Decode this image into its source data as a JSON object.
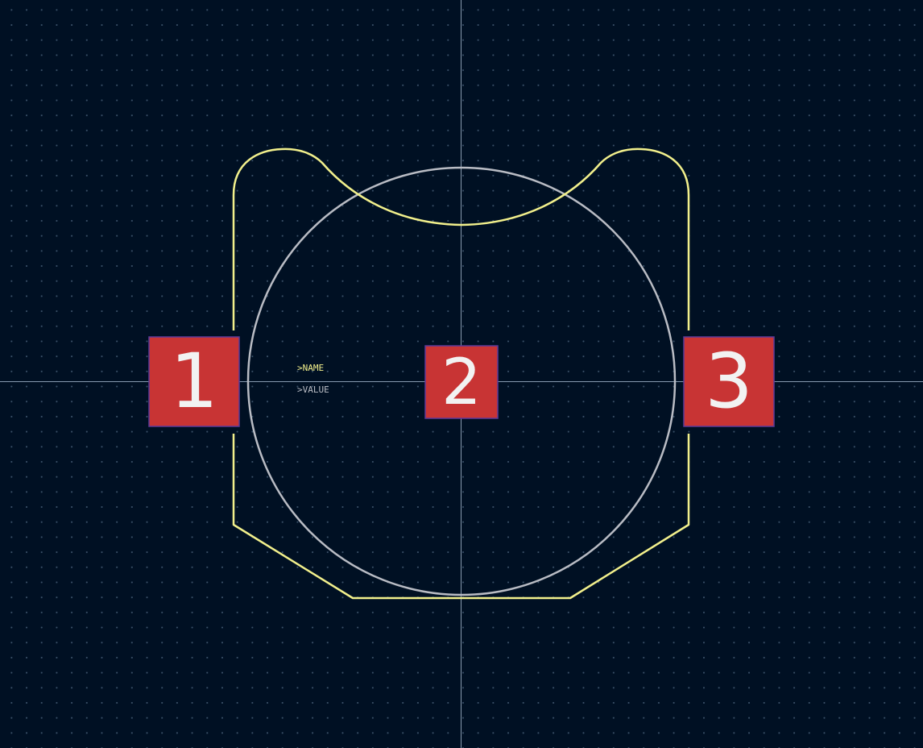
{
  "footprint": {
    "name_text": ">NAME",
    "value_text": ">VALUE",
    "pads": [
      {
        "number": "1"
      },
      {
        "number": "2"
      },
      {
        "number": "3"
      }
    ]
  },
  "colors": {
    "background": "#001023",
    "grid_dot": "#3a5068",
    "crosshair": "#9fb3c8",
    "silkscreen": "#f2f08c",
    "courtyard": "#b9bcc4",
    "pad_fill": "#c83434",
    "pad_outline": "#5a3a9a",
    "pad_text": "#f2f2f2"
  }
}
